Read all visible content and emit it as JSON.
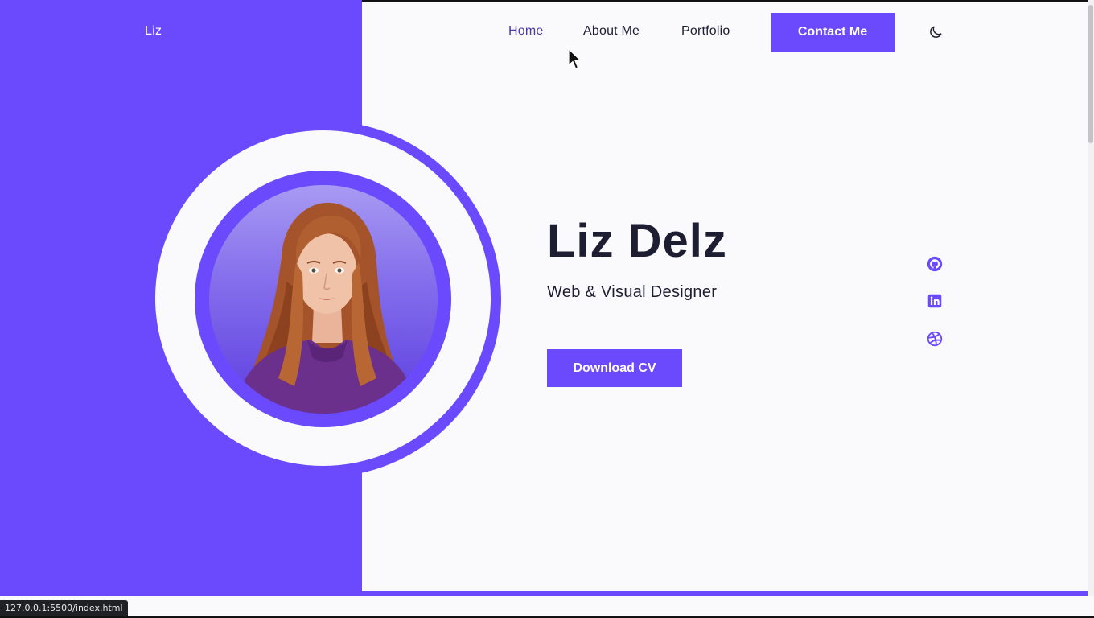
{
  "brand": {
    "name": "Liz"
  },
  "nav": {
    "items": [
      {
        "label": "Home",
        "active": true
      },
      {
        "label": "About Me",
        "active": false
      },
      {
        "label": "Portfolio",
        "active": false
      }
    ],
    "contact_label": "Contact Me",
    "theme_icon": "moon-icon"
  },
  "hero": {
    "name": "Liz Delz",
    "role": "Web & Visual Designer",
    "cta_label": "Download CV",
    "social_icons": [
      "github-icon",
      "linkedin-icon",
      "dribbble-icon"
    ]
  },
  "status_bar": {
    "url": "127.0.0.1:5500/index.html"
  },
  "colors": {
    "accent": "#6a4afc",
    "background": "#fafafd",
    "text": "#1e1e32",
    "active_nav": "#4a3aa8"
  }
}
